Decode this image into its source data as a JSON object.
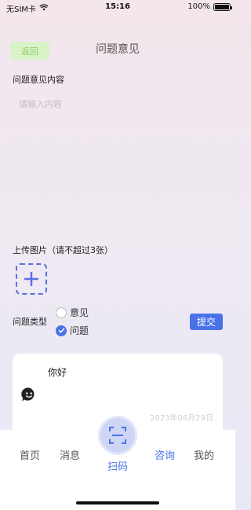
{
  "status_bar": {
    "carrier": "无SIM卡",
    "time": "15:16",
    "battery": "100%",
    "battery_level": 1.0
  },
  "header": {
    "back_label": "返回",
    "title": "问题意见"
  },
  "form": {
    "content_label": "问题意见内容",
    "content_placeholder": "请输入内容",
    "content_value": "",
    "upload_label": "上传图片（请不超过3张）",
    "type_label": "问题类型",
    "type_options": [
      {
        "label": "意见",
        "checked": false
      },
      {
        "label": "问题",
        "checked": true
      }
    ],
    "submit_label": "提交"
  },
  "card": {
    "message": "你好",
    "date": "2023年06月29日"
  },
  "tabbar": {
    "tabs": [
      {
        "label": "首页",
        "active": false
      },
      {
        "label": "消息",
        "active": false
      },
      {
        "label": "咨询",
        "active": true
      },
      {
        "label": "我的",
        "active": false
      }
    ],
    "scan_label": "扫码"
  },
  "colors": {
    "accent": "#4a72e8",
    "back_button_bg": "#d9f2c7",
    "back_button_text": "#8fd36a"
  }
}
